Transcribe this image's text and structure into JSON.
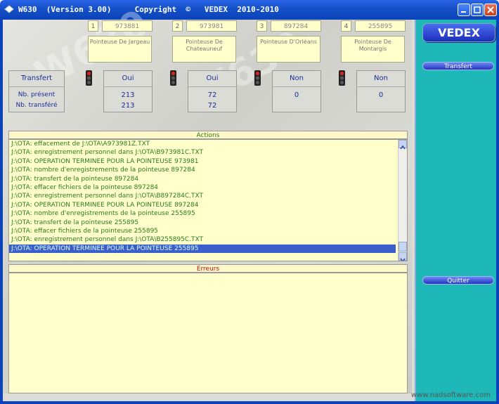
{
  "window": {
    "title": "W630  (Version 3.00)     Copyright  ©   VEDEX  2010-2010"
  },
  "pointeuses": [
    {
      "num": "1",
      "id": "973881",
      "name": "Pointeuse De Jargeau",
      "light": "red",
      "status": "Oui",
      "present": "213",
      "transfere": "213"
    },
    {
      "num": "2",
      "id": "973981",
      "name": "Pointeuse De Chateauneuf",
      "light": "red",
      "status": "Oui",
      "present": "72",
      "transfere": "72"
    },
    {
      "num": "3",
      "id": "897284",
      "name": "Pointeuse D'Orléans",
      "light": "red",
      "status": "Non",
      "present": "0",
      "transfere": ""
    },
    {
      "num": "4",
      "id": "255895",
      "name": "Pointeuse De Montargis",
      "light": "red",
      "status": "Non",
      "present": "0",
      "transfere": ""
    }
  ],
  "transfert_panel": {
    "header": "Transfert",
    "present_label": "Nb. présent",
    "transfere_label": "Nb. transféré"
  },
  "actions": {
    "header": "Actions",
    "lines": [
      "J:\\OTA: effacement de J:\\OTA\\A973981Z.TXT",
      "J:\\OTA: enregistrement personnel dans J:\\OTA\\B973981C.TXT",
      "J:\\OTA: OPERATION TERMINEE POUR LA POINTEUSE 973981",
      "J:\\OTA: nombre d'enregistrements de la pointeuse 897284",
      "J:\\OTA: transfert de la pointeuse 897284",
      "J:\\OTA: effacer fichiers de la pointeuse 897284",
      "J:\\OTA: enregistrement personnel dans J:\\OTA\\B897284C.TXT",
      "J:\\OTA: OPERATION TERMINEE POUR LA POINTEUSE 897284",
      "J:\\OTA: nombre d'enregistrements de la pointeuse 255895",
      "J:\\OTA: transfert de la pointeuse 255895",
      "J:\\OTA: effacer fichiers de la pointeuse 255895",
      "J:\\OTA: enregistrement personnel dans J:\\OTA\\B255895C.TXT",
      "J:\\OTA: OPERATION TERMINEE POUR LA POINTEUSE 255895"
    ],
    "selected_index": 12
  },
  "errors": {
    "header": "Erreurs"
  },
  "sidebar": {
    "vedex_label": "VEDEX",
    "transfert_label": "Transfert",
    "quitter_label": "Quitter"
  },
  "footer": {
    "url": "www.nadsoftware.com"
  },
  "colors": {
    "titlebar": "#1550c8",
    "sidebar": "#1fb8b8",
    "log_text": "#2a7a1c",
    "selection": "#3a5fcd",
    "errors_header": "#c01010"
  }
}
